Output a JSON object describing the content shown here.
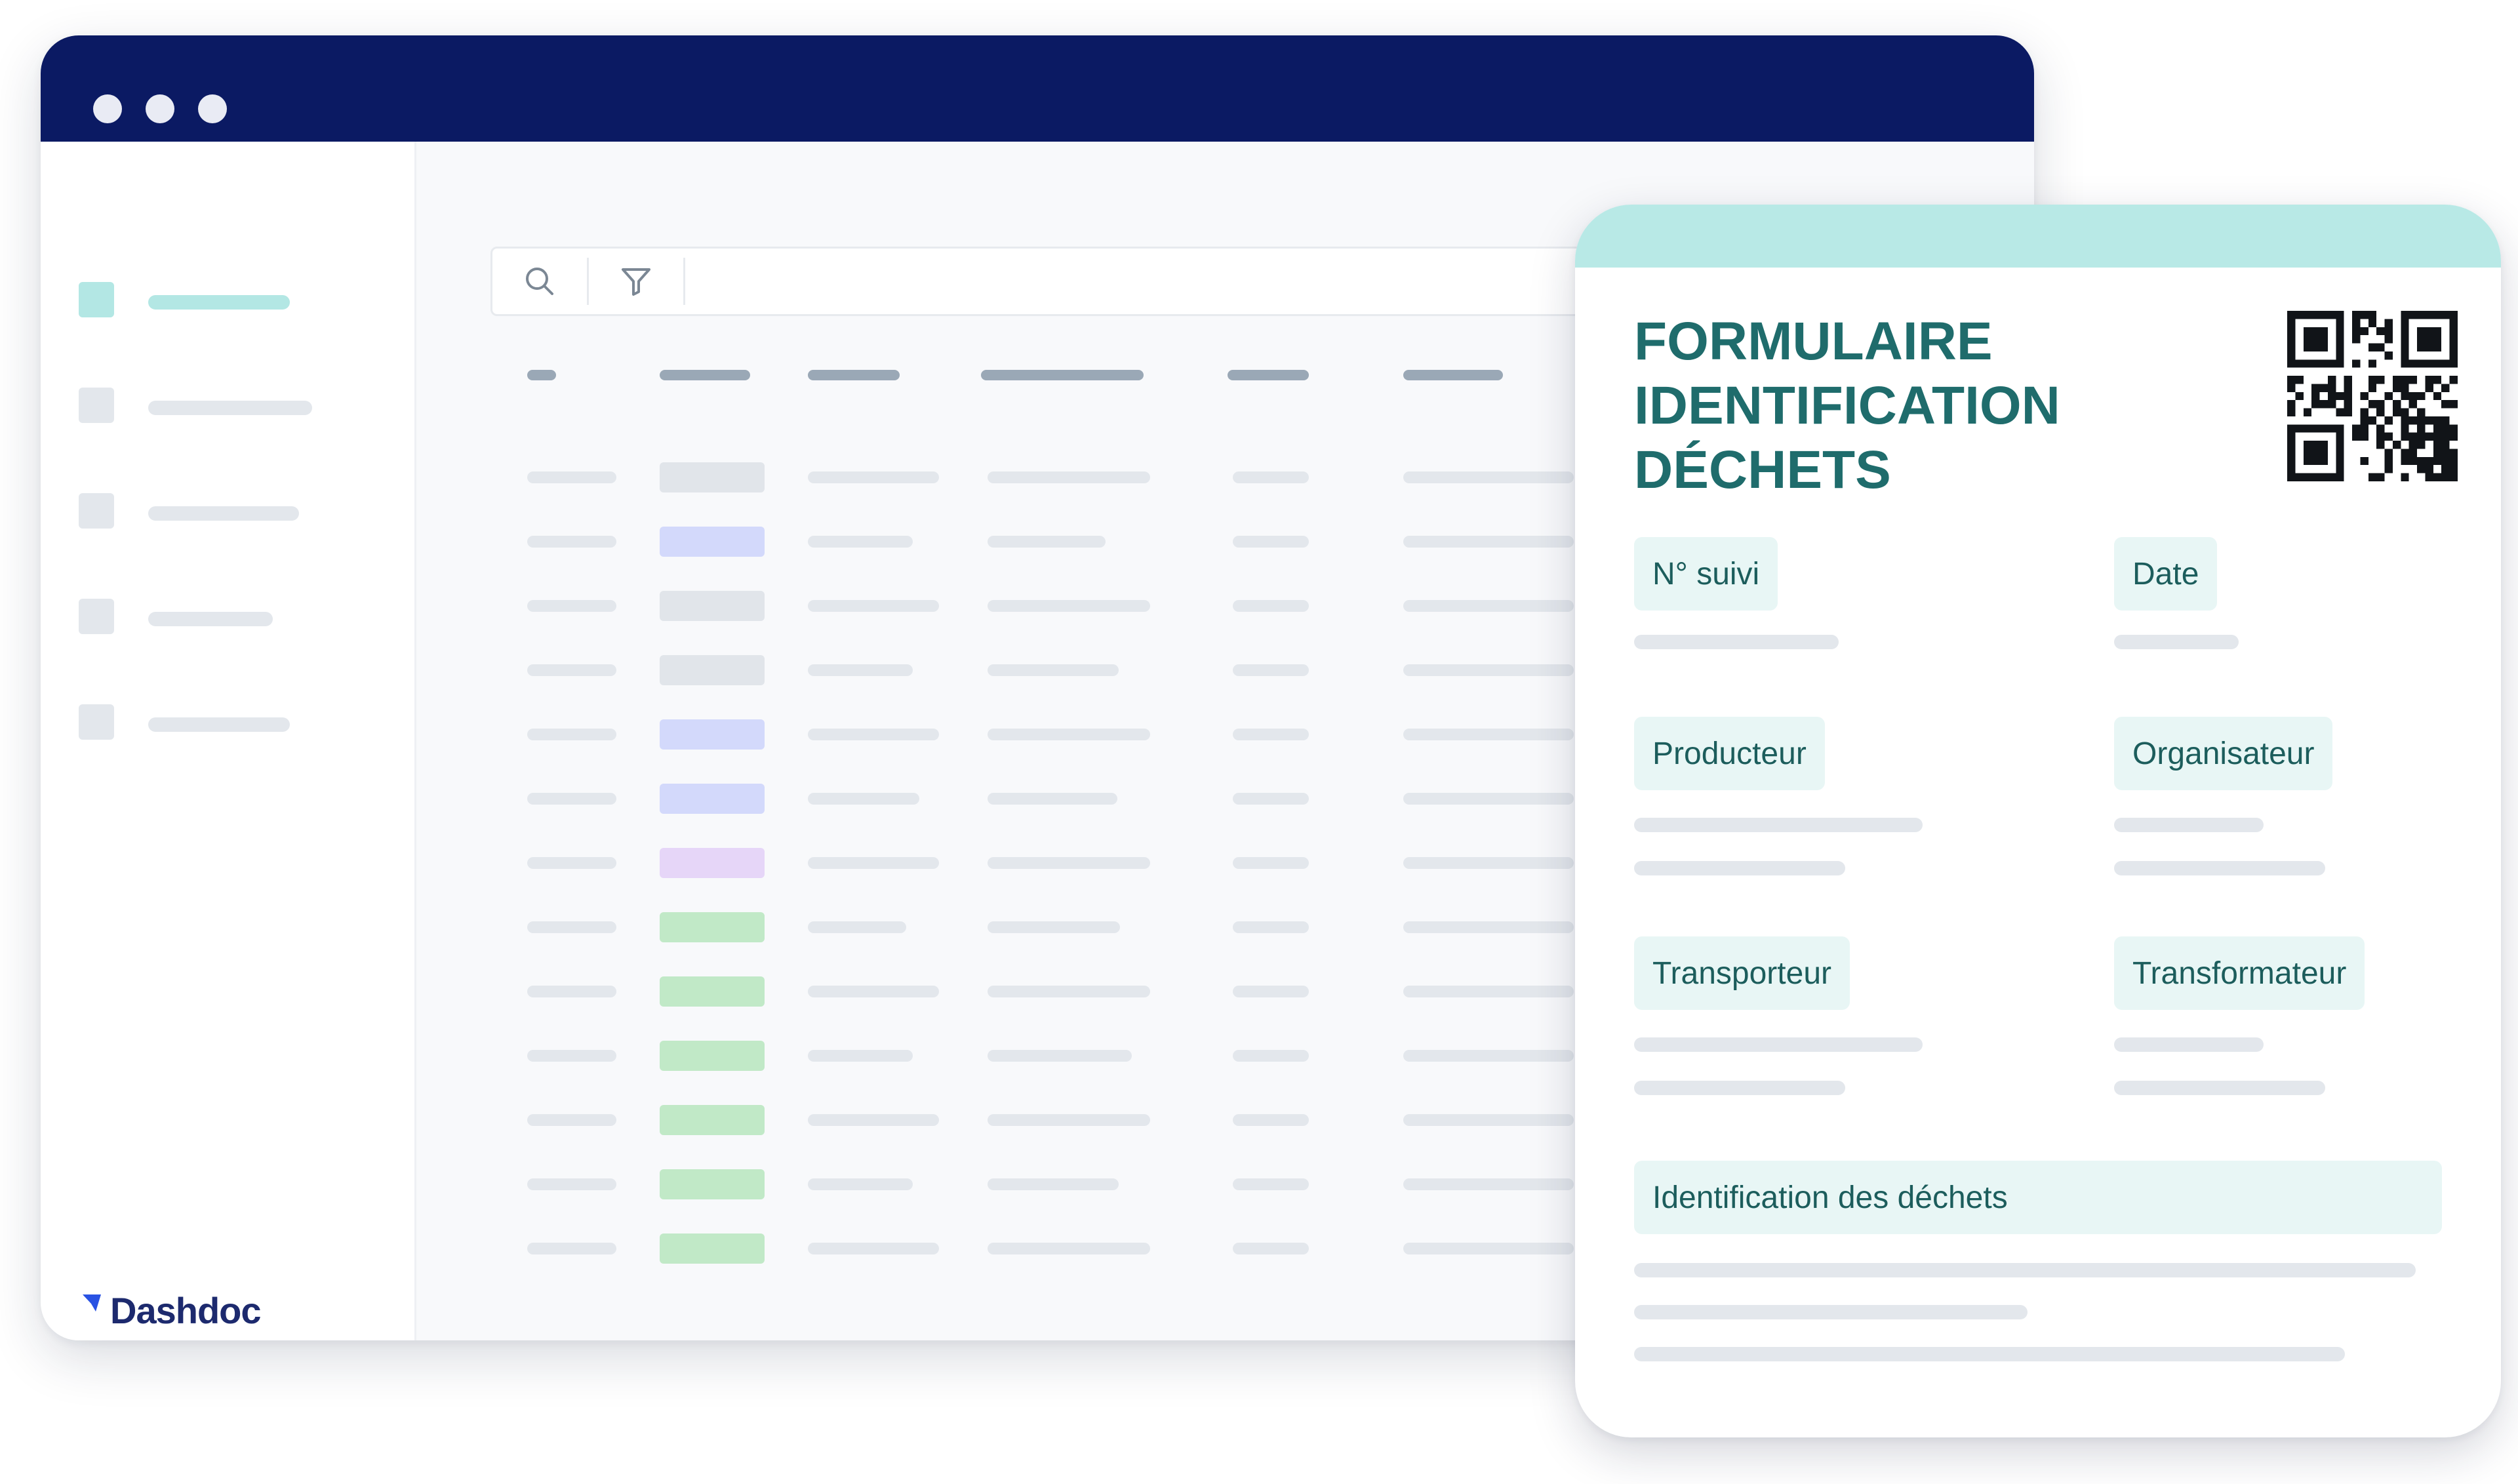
{
  "app": {
    "window_dots": 3,
    "brand": {
      "name": "Dashdoc",
      "accent": "#2952e3"
    },
    "titlebar_color": "#0b1a63",
    "sidebar": {
      "items": [
        {
          "id": "nav-item-1",
          "active": true
        },
        {
          "id": "nav-item-2",
          "active": false
        },
        {
          "id": "nav-item-3",
          "active": false
        },
        {
          "id": "nav-item-4",
          "active": false
        },
        {
          "id": "nav-item-5",
          "active": false
        }
      ]
    },
    "toolbar": {
      "icons": [
        "search-icon",
        "filter-icon"
      ]
    },
    "table": {
      "column_count": 6,
      "row_count": 13,
      "status_colors": {
        "gray": "#e1e5ea",
        "blue": "#d3d9fb",
        "purple": "#e6d6f8",
        "green": "#c1e9c7"
      },
      "row_status": [
        "gray",
        "blue",
        "gray",
        "gray",
        "blue",
        "blue",
        "purple",
        "green",
        "green",
        "green",
        "green",
        "green",
        "green"
      ]
    }
  },
  "form": {
    "title_lines": [
      "FORMULAIRE",
      "IDENTIFICATION",
      "DÉCHETS"
    ],
    "qr_icon": "qr-code-icon",
    "fields": {
      "tracking_number": "N° suivi",
      "date": "Date",
      "producer": "Producteur",
      "organizer": "Organisateur",
      "carrier": "Transporteur",
      "processor": "Transformateur",
      "waste_identification": "Identification des déchets"
    },
    "colors": {
      "band": "#b8e9e6",
      "label_bg": "#e8f6f5",
      "title": "#1f6c6c"
    }
  }
}
